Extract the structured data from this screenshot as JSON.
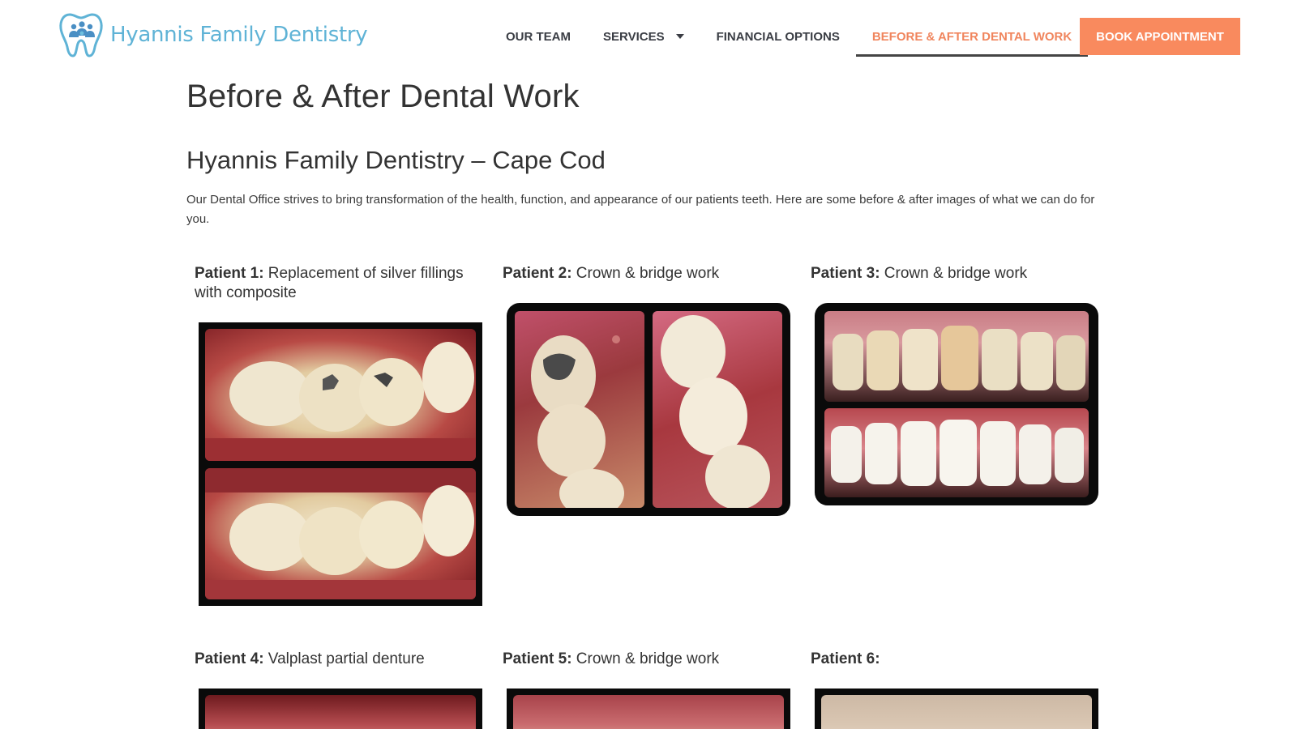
{
  "brand": {
    "name": "Hyannis Family Dentistry",
    "logo_icon": "tooth-family-icon",
    "color": "#5fb3d6"
  },
  "nav": {
    "items": [
      {
        "label": "OUR TEAM"
      },
      {
        "label": "SERVICES",
        "has_dropdown": true
      },
      {
        "label": "FINANCIAL OPTIONS"
      },
      {
        "label": "BEFORE & AFTER DENTAL WORK",
        "active": true
      }
    ],
    "cta": "BOOK APPOINTMENT",
    "accent_color": "#f0855d"
  },
  "page": {
    "title": "Before & After Dental Work",
    "subtitle": "Hyannis Family Dentistry – Cape Cod",
    "intro": "Our Dental Office strives to bring transformation of the health, function, and appearance of our patients teeth. Here are some before & after images of what we can do for you."
  },
  "patients": [
    {
      "label": "Patient 1:",
      "desc": " Replacement of silver fillings with composite"
    },
    {
      "label": "Patient 2:",
      "desc": " Crown & bridge work"
    },
    {
      "label": "Patient 3:",
      "desc": " Crown & bridge work"
    },
    {
      "label": "Patient 4:",
      "desc": " Valplast partial denture"
    },
    {
      "label": "Patient 5:",
      "desc": " Crown & bridge work"
    },
    {
      "label": "Patient 6:",
      "desc": ""
    }
  ]
}
